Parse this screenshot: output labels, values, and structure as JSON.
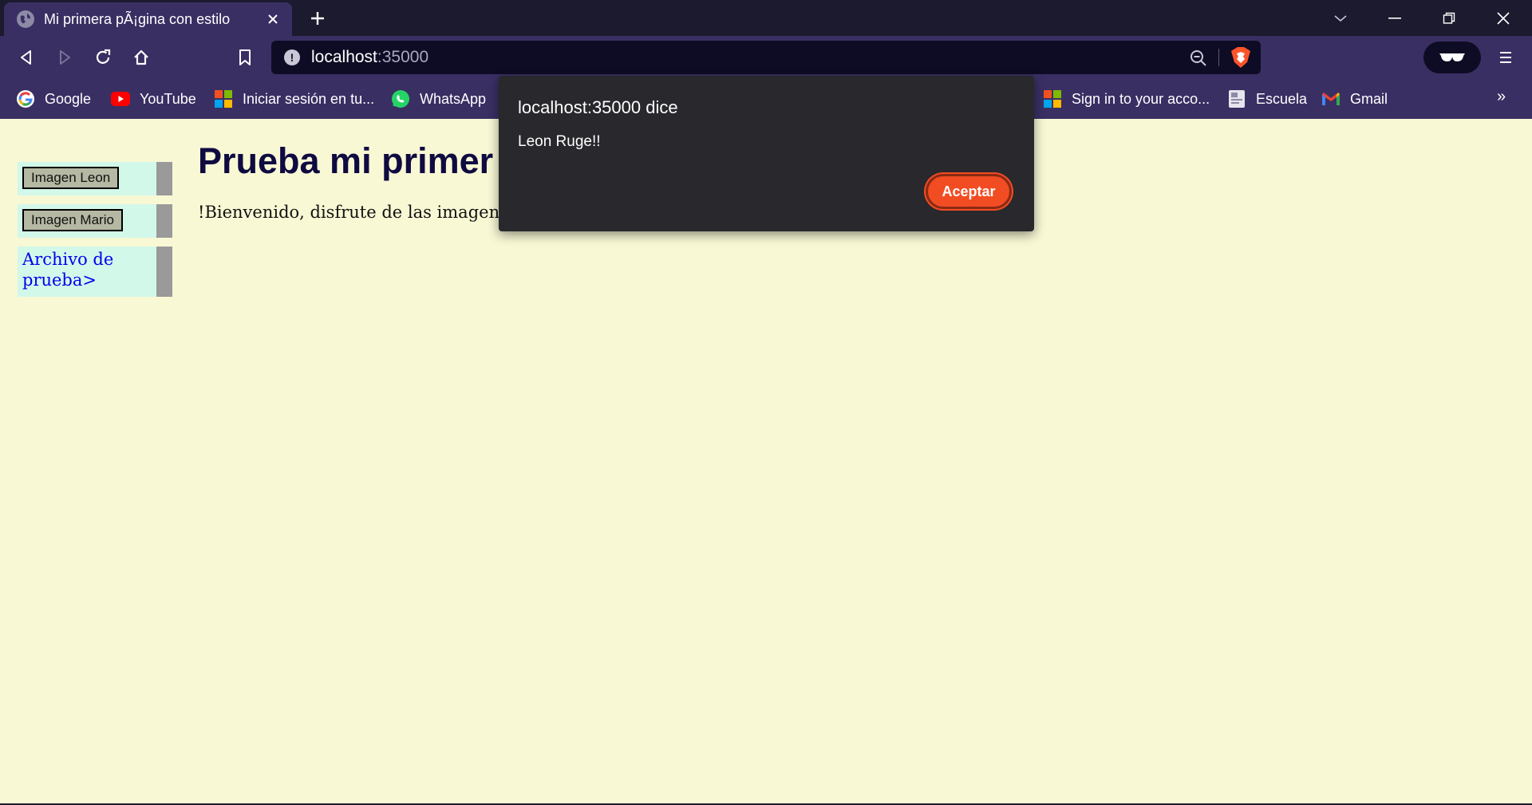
{
  "browser": {
    "tab": {
      "title": "Mi primera pÃ¡gina con estilo"
    },
    "address": {
      "host": "localhost",
      "port": ":35000"
    },
    "bookmarks": [
      {
        "label": "Google",
        "icon": "google-icon"
      },
      {
        "label": "YouTube",
        "icon": "youtube-icon"
      },
      {
        "label": "Iniciar sesión en tu...",
        "icon": "microsoft-icon"
      },
      {
        "label": "WhatsApp",
        "icon": "whatsapp-icon"
      },
      {
        "label": "Sign in to your acco...",
        "icon": "microsoft-icon"
      },
      {
        "label": "Escuela",
        "icon": "folder-icon"
      },
      {
        "label": "Gmail",
        "icon": "gmail-icon"
      }
    ],
    "more_label": "»",
    "colors": {
      "frame": "#3a2f63",
      "tabstrip": "#1b1a2e",
      "omnibox": "#0e0c24"
    }
  },
  "page": {
    "nav": {
      "btn_leon": "Imagen Leon",
      "btn_mario": "Imagen Mario",
      "link_archivo": "Archivo de prueba>"
    },
    "heading": "Prueba mi primer s",
    "paragraph": "!Bienvenido, disfrute de las imagenes de",
    "colors": {
      "background": "#f8f8d5",
      "nav_bg": "#d2f8e9",
      "heading": "#0f0a40",
      "link": "#0000ee"
    }
  },
  "dialog": {
    "title": "localhost:35000 dice",
    "message": "Leon Ruge!!",
    "ok_label": "Aceptar",
    "colors": {
      "background": "#28282d",
      "button": "#f24c22"
    }
  }
}
